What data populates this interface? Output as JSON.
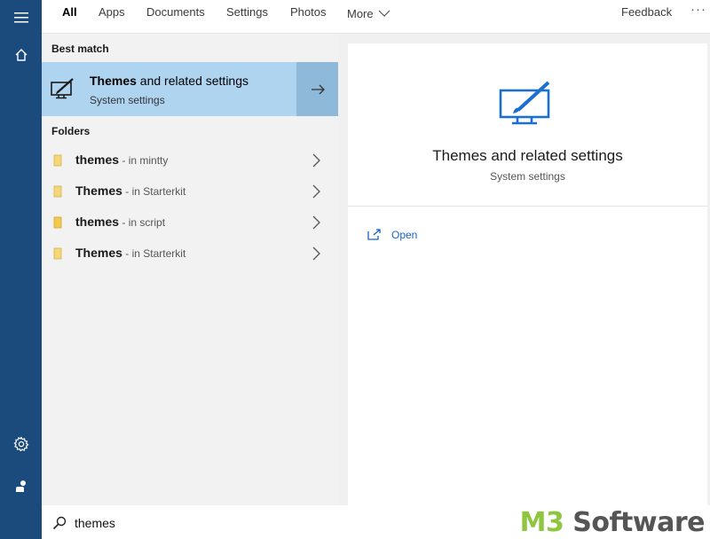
{
  "rail": {
    "icons": [
      "hamburger-icon",
      "home-icon",
      "gear-icon",
      "user-icon"
    ]
  },
  "tabs": {
    "items": [
      {
        "label": "All",
        "active": true
      },
      {
        "label": "Apps"
      },
      {
        "label": "Documents"
      },
      {
        "label": "Settings"
      },
      {
        "label": "Photos"
      },
      {
        "label": "More"
      }
    ],
    "feedback": "Feedback",
    "more_options": "···"
  },
  "results": {
    "best_match_label": "Best match",
    "best_match": {
      "title_bold": "Themes",
      "title_rest": " and related settings",
      "subtitle": "System settings"
    },
    "folders_label": "Folders",
    "folders": [
      {
        "name": "themes",
        "location": " - in mintty"
      },
      {
        "name": "Themes",
        "location": " - in Starterkit"
      },
      {
        "name": "themes",
        "location": " - in script"
      },
      {
        "name": "Themes",
        "location": " - in Starterkit"
      }
    ]
  },
  "preview": {
    "title": "Themes and related settings",
    "subtitle": "System settings",
    "open_label": "Open"
  },
  "search": {
    "value": "themes"
  },
  "watermark": {
    "part1": "M3",
    "part2": " Software"
  },
  "colors": {
    "rail": "#1b4a7d",
    "highlight": "#aed4f0",
    "accent": "#1565c0",
    "watermark_green": "#8ec63f"
  }
}
